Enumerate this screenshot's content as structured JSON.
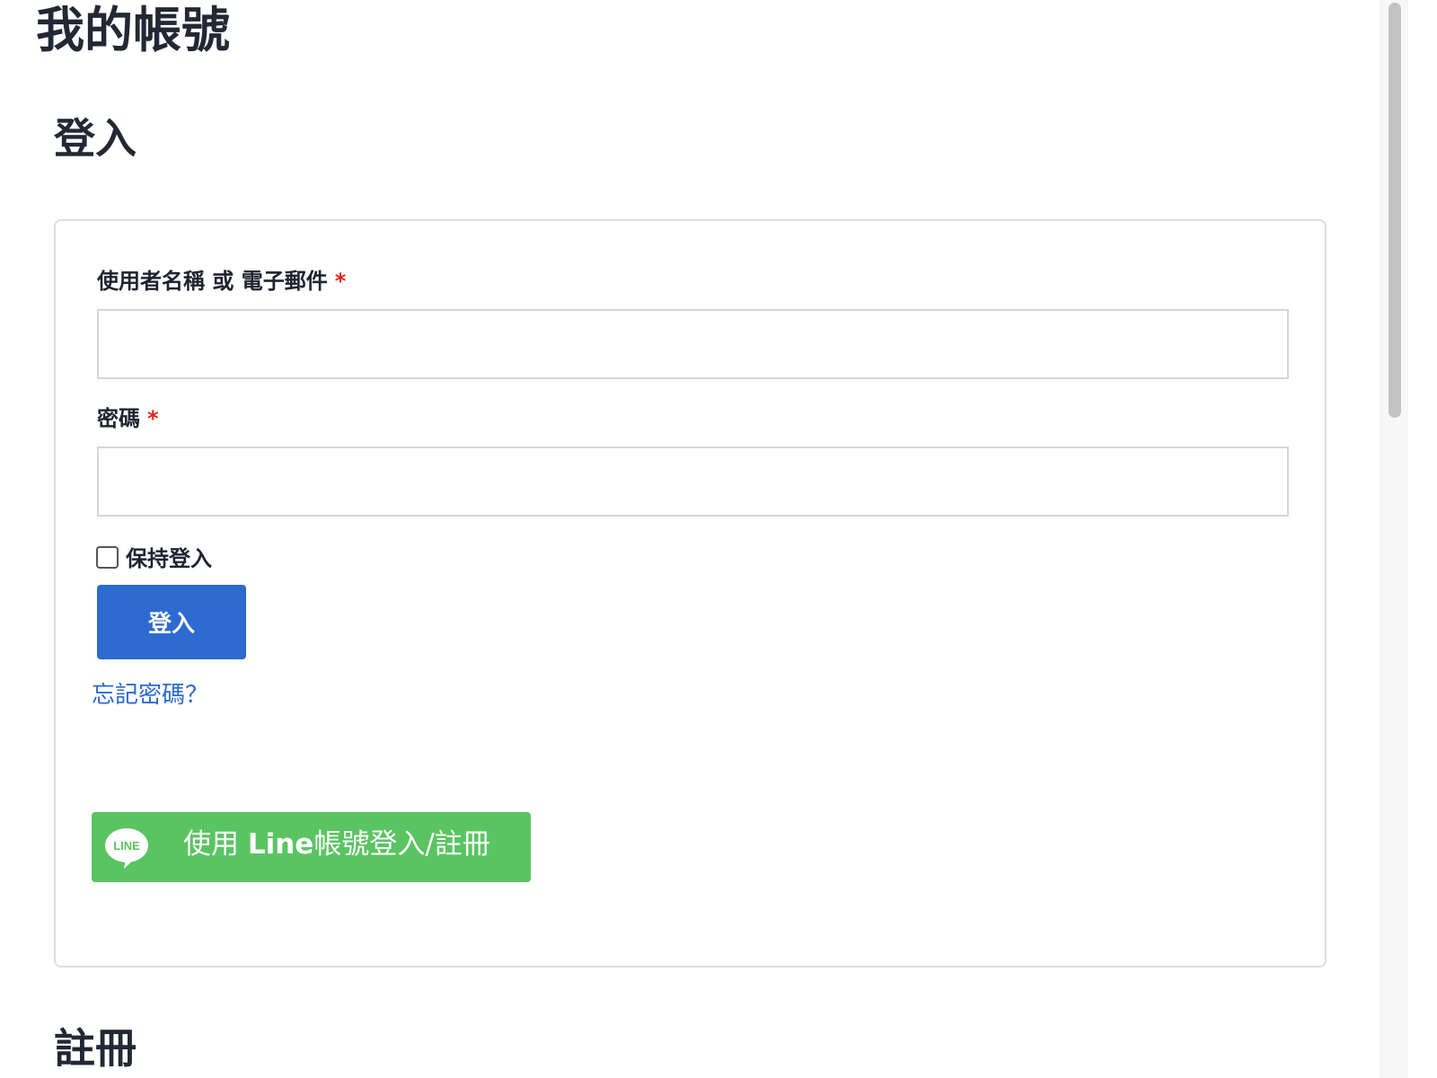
{
  "page": {
    "title": "我的帳號"
  },
  "login": {
    "heading": "登入",
    "username_label": "使用者名稱 或 電子郵件",
    "username_value": "",
    "password_label": "密碼",
    "password_value": "",
    "required_mark": "*",
    "remember_label": "保持登入",
    "remember_checked": false,
    "submit_label": "登入",
    "forgot_password": "忘記密碼？",
    "line_button": {
      "prefix": "使用 ",
      "brand": "Line",
      "suffix": "帳號登入/註冊",
      "icon": "line-logo-icon",
      "icon_text": "LINE"
    }
  },
  "register": {
    "heading": "註冊"
  },
  "colors": {
    "primary": "#2d6acf",
    "line_green": "#5ac462",
    "required": "#e2231a",
    "heading": "#222834"
  }
}
